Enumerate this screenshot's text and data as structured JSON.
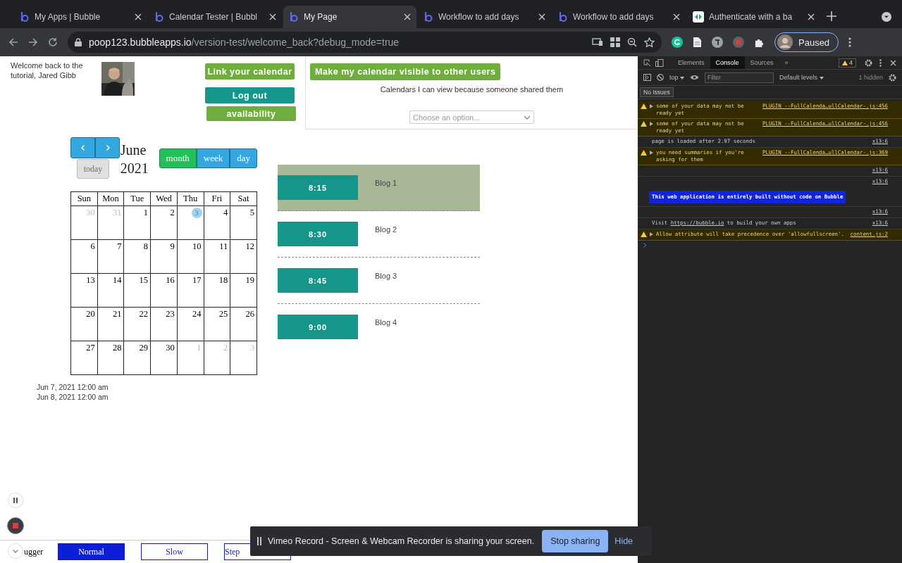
{
  "browser": {
    "tabs": [
      {
        "title": "My Apps | Bubble",
        "selected": false
      },
      {
        "title": "Calendar Tester | Bubbl",
        "selected": false
      },
      {
        "title": "My Page",
        "selected": true
      },
      {
        "title": "Workflow to add days",
        "selected": false
      },
      {
        "title": "Workflow to add days",
        "selected": false
      },
      {
        "title": "Authenticate with a ba",
        "selected": false
      }
    ],
    "url_host": "poop123.bubbleapps.io",
    "url_path": "/version-test/welcome_back?debug_mode=true",
    "profile": "Paused"
  },
  "page": {
    "welcome": "Welcome back to the tutorial, Jared Gibb",
    "buttons": [
      {
        "label": "Link your calendar",
        "kind": "green"
      },
      {
        "label": "Log out",
        "kind": "teal"
      },
      {
        "label": "availability",
        "kind": "green"
      }
    ],
    "share_panel": {
      "button": "Make my calendar visible to other users",
      "caption": "Calendars I can view because someone shared them",
      "dropdown": {
        "placeholder": "Choose an option..."
      }
    },
    "calendar": {
      "month": "June",
      "year": "2021",
      "today": "today",
      "today_disabled": true,
      "views": [
        {
          "label": "month",
          "selected": true
        },
        {
          "label": "week",
          "selected": false
        },
        {
          "label": "day",
          "selected": false
        }
      ],
      "weekdays": [
        "Sun",
        "Mon",
        "Tue",
        "Wed",
        "Thu",
        "Fri",
        "Sat"
      ],
      "weeks": [
        [
          {
            "day": "30",
            "other_month": true,
            "today": false
          },
          {
            "day": "31",
            "other_month": true,
            "today": false
          },
          {
            "day": "1",
            "other_month": false,
            "today": false
          },
          {
            "day": "2",
            "other_month": false,
            "today": false
          },
          {
            "day": "3",
            "other_month": false,
            "today": true
          },
          {
            "day": "4",
            "other_month": false,
            "today": false
          },
          {
            "day": "5",
            "other_month": false,
            "today": false
          }
        ],
        [
          {
            "day": "6",
            "other_month": false,
            "today": false
          },
          {
            "day": "7",
            "other_month": false,
            "today": false
          },
          {
            "day": "8",
            "other_month": false,
            "today": false
          },
          {
            "day": "9",
            "other_month": false,
            "today": false
          },
          {
            "day": "10",
            "other_month": false,
            "today": false
          },
          {
            "day": "11",
            "other_month": false,
            "today": false
          },
          {
            "day": "12",
            "other_month": false,
            "today": false
          }
        ],
        [
          {
            "day": "13",
            "other_month": false,
            "today": false
          },
          {
            "day": "14",
            "other_month": false,
            "today": false
          },
          {
            "day": "15",
            "other_month": false,
            "today": false
          },
          {
            "day": "16",
            "other_month": false,
            "today": false
          },
          {
            "day": "17",
            "other_month": false,
            "today": false
          },
          {
            "day": "18",
            "other_month": false,
            "today": false
          },
          {
            "day": "19",
            "other_month": false,
            "today": false
          }
        ],
        [
          {
            "day": "20",
            "other_month": false,
            "today": false
          },
          {
            "day": "21",
            "other_month": false,
            "today": false
          },
          {
            "day": "22",
            "other_month": false,
            "today": false
          },
          {
            "day": "23",
            "other_month": false,
            "today": false
          },
          {
            "day": "24",
            "other_month": false,
            "today": false
          },
          {
            "day": "25",
            "other_month": false,
            "today": false
          },
          {
            "day": "26",
            "other_month": false,
            "today": false
          }
        ],
        [
          {
            "day": "27",
            "other_month": false,
            "today": false
          },
          {
            "day": "28",
            "other_month": false,
            "today": false
          },
          {
            "day": "29",
            "other_month": false,
            "today": false
          },
          {
            "day": "30",
            "other_month": false,
            "today": false
          },
          {
            "day": "1",
            "other_month": true,
            "today": false
          },
          {
            "day": "2",
            "other_month": true,
            "today": false
          },
          {
            "day": "3",
            "other_month": true,
            "today": false
          }
        ]
      ]
    },
    "dates": [
      "Jun 7, 2021 12:00 am",
      "Jun 8, 2021 12:00 am"
    ],
    "slots": [
      {
        "time": "8:15",
        "title": "Blog 1",
        "selected": true
      },
      {
        "time": "8:30",
        "title": "Blog 2",
        "selected": false
      },
      {
        "time": "8:45",
        "title": "Blog 3",
        "selected": false
      },
      {
        "time": "9:00",
        "title": "Blog 4",
        "selected": false
      }
    ],
    "debugger": {
      "label": "ugger",
      "speeds": [
        {
          "label": "Normal",
          "selected": true
        },
        {
          "label": "Slow",
          "selected": false
        },
        {
          "label": "Step",
          "selected": false
        }
      ]
    }
  },
  "devtools": {
    "tabs": [
      {
        "label": "Elements",
        "selected": false
      },
      {
        "label": "Console",
        "selected": true
      },
      {
        "label": "Sources",
        "selected": false
      }
    ],
    "more": "»",
    "warning_count": "4",
    "context": "top",
    "filter_placeholder": "Filter",
    "levels": "Default levels",
    "hidden": "1 hidden",
    "issues": "No Issues",
    "messages": [
      {
        "kind": "warning",
        "text": "some of your data may not be ready yet",
        "source": "PLUGIN_--FullCalenda…ullCalendar-.js:456"
      },
      {
        "kind": "warning",
        "text": "some of your data may not be ready yet",
        "source": "PLUGIN_--FullCalenda…ullCalendar-.js:456"
      },
      {
        "kind": "info",
        "text": "page is loaded after 2.97 seconds",
        "source": "x13:6"
      },
      {
        "kind": "warning",
        "text": "you need summaries if you're asking for them",
        "source": "PLUGIN_--FullCalenda…ullCalendar-.js:369"
      },
      {
        "kind": "info",
        "source": "x13:6"
      },
      {
        "kind": "banner",
        "text": "This web application is entirely built without code on Bubble",
        "source": "x13:6"
      },
      {
        "kind": "info",
        "source": "x13:6"
      },
      {
        "kind": "info",
        "text": "Visit ",
        "link": "https://bubble.io",
        "text_after": " to build your own apps",
        "source": "x13:6"
      },
      {
        "kind": "warning",
        "text": "Allow attribute will take precedence over 'allowfullscreen'.",
        "source": "content.js:2"
      }
    ]
  },
  "share_bar": {
    "message": "Vimeo Record - Screen & Webcam Recorder is sharing your screen.",
    "stop": "Stop sharing",
    "hide": "Hide"
  }
}
